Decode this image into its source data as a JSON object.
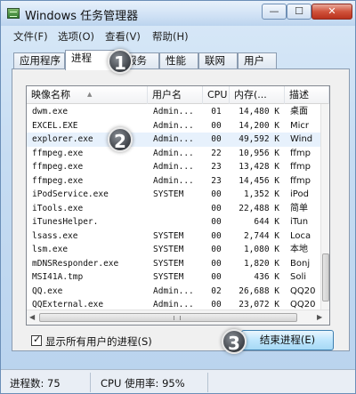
{
  "window": {
    "title": "Windows 任务管理器",
    "min_label": "—",
    "max_label": "☐",
    "close_label": "✕"
  },
  "menu": [
    {
      "label": "文件(F)"
    },
    {
      "label": "选项(O)"
    },
    {
      "label": "查看(V)"
    },
    {
      "label": "帮助(H)"
    }
  ],
  "tabs": [
    {
      "label": "应用程序"
    },
    {
      "label": "进程"
    },
    {
      "label": "服务"
    },
    {
      "label": "性能"
    },
    {
      "label": "联网"
    },
    {
      "label": "用户"
    }
  ],
  "active_tab": "进程",
  "columns": {
    "name": "映像名称",
    "user": "用户名",
    "cpu": "CPU",
    "mem": "内存(...",
    "desc": "描述"
  },
  "rows": [
    {
      "name": "dwm.exe",
      "user": "Admin...",
      "cpu": "01",
      "mem": "14,480 K",
      "desc": "桌面"
    },
    {
      "name": "EXCEL.EXE",
      "user": "Admin...",
      "cpu": "00",
      "mem": "14,200 K",
      "desc": "Micr"
    },
    {
      "name": "explorer.exe",
      "user": "Admin...",
      "cpu": "00",
      "mem": "49,592 K",
      "desc": "Wind"
    },
    {
      "name": "ffmpeg.exe",
      "user": "Admin...",
      "cpu": "22",
      "mem": "10,956 K",
      "desc": "ffmp"
    },
    {
      "name": "ffmpeg.exe",
      "user": "Admin...",
      "cpu": "23",
      "mem": "13,428 K",
      "desc": "ffmp"
    },
    {
      "name": "ffmpeg.exe",
      "user": "Admin...",
      "cpu": "23",
      "mem": "14,456 K",
      "desc": "ffmp"
    },
    {
      "name": "iPodService.exe",
      "user": "SYSTEM",
      "cpu": "00",
      "mem": "1,352 K",
      "desc": "iPod"
    },
    {
      "name": "iTools.exe",
      "user": "",
      "cpu": "00",
      "mem": "22,488 K",
      "desc": "简单"
    },
    {
      "name": "iTunesHelper.",
      "user": "",
      "cpu": "00",
      "mem": "644 K",
      "desc": "iTun"
    },
    {
      "name": "lsass.exe",
      "user": "SYSTEM",
      "cpu": "00",
      "mem": "2,744 K",
      "desc": "Loca"
    },
    {
      "name": "lsm.exe",
      "user": "SYSTEM",
      "cpu": "00",
      "mem": "1,080 K",
      "desc": "本地"
    },
    {
      "name": "mDNSResponder.exe",
      "user": "SYSTEM",
      "cpu": "00",
      "mem": "1,820 K",
      "desc": "Bonj"
    },
    {
      "name": "MSI41A.tmp",
      "user": "SYSTEM",
      "cpu": "00",
      "mem": "436 K",
      "desc": "Soli"
    },
    {
      "name": "QQ.exe",
      "user": "Admin...",
      "cpu": "02",
      "mem": "26,688 K",
      "desc": "QQ20"
    },
    {
      "name": "QQExternal.exe",
      "user": "Admin...",
      "cpu": "00",
      "mem": "23,072 K",
      "desc": "QQ20"
    }
  ],
  "selected_row": "explorer.exe",
  "markers": [
    "1",
    "2",
    "3"
  ],
  "show_all_users": {
    "label": "显示所有用户的进程(S)",
    "checked": true,
    "check_glyph": "✓"
  },
  "end_process_label": "结束进程(E)",
  "status": {
    "processes": "进程数: 75",
    "cpu": "CPU 使用率: 95%"
  },
  "colors": {
    "selection": "#e7f1fc",
    "end_button_border": "#3c7fb1",
    "close_button": "#c8432b"
  }
}
